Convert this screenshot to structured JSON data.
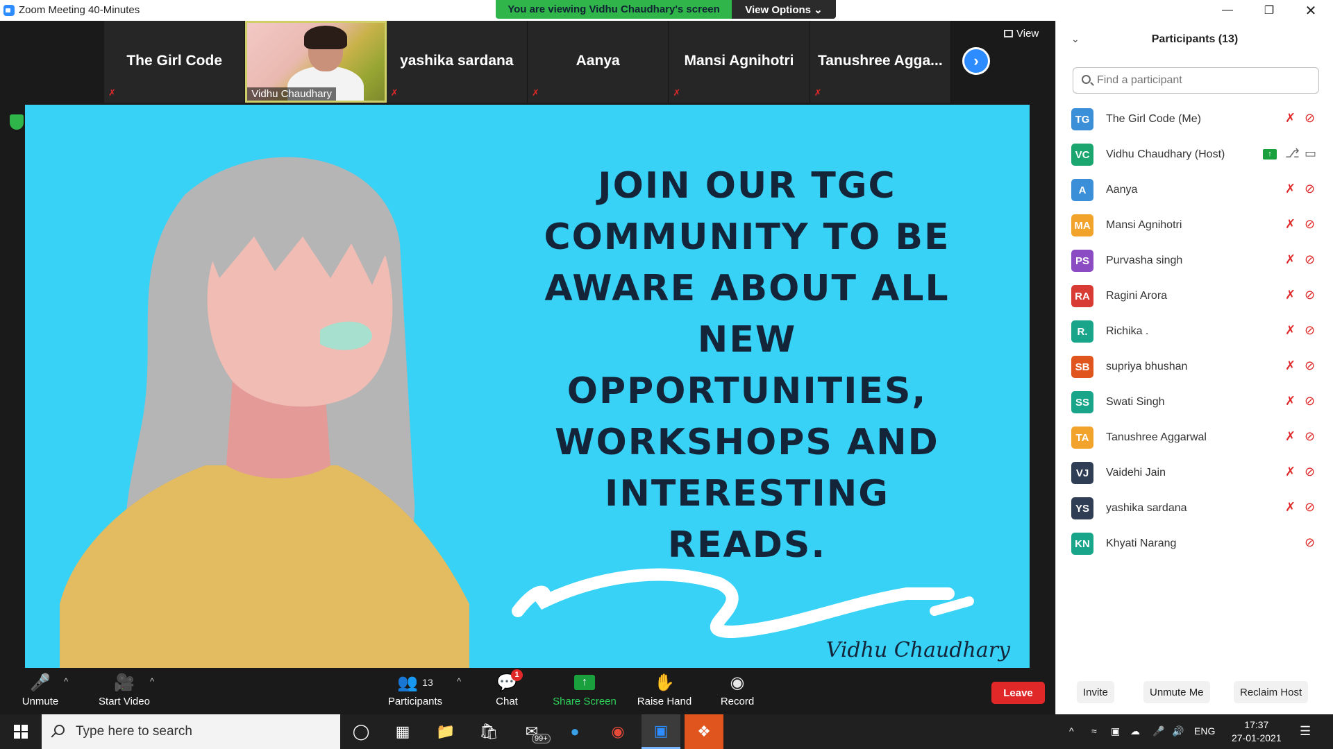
{
  "window": {
    "title": "Zoom Meeting 40-Minutes",
    "banner": "You are viewing Vidhu Chaudhary's screen",
    "view_options": "View Options ⌄"
  },
  "thumbnails": [
    {
      "name": "The Girl Code",
      "type": "name"
    },
    {
      "name": "Vidhu Chaudhary",
      "type": "video"
    },
    {
      "name": "yashika sardana",
      "type": "name"
    },
    {
      "name": "Aanya",
      "type": "name"
    },
    {
      "name": "Mansi Agnihotri",
      "type": "name"
    },
    {
      "name": "Tanushree  Agga...",
      "type": "name"
    }
  ],
  "view_label": "View",
  "slide": {
    "lines": [
      "JOIN OUR TGC",
      "COMMUNITY TO BE",
      "AWARE ABOUT ALL",
      "NEW",
      "OPPORTUNITIES,",
      "WORKSHOPS AND",
      "INTERESTING",
      "READS."
    ],
    "signature": "Vidhu Chaudhary",
    "bg_color": "#37d2f6"
  },
  "toolbar": {
    "unmute": "Unmute",
    "start_video": "Start Video",
    "participants": "Participants",
    "participant_count": "13",
    "chat": "Chat",
    "chat_badge": "1",
    "share_screen": "Share Screen",
    "raise_hand": "Raise Hand",
    "record": "Record",
    "leave": "Leave"
  },
  "sidebar": {
    "title": "Participants (13)",
    "search_placeholder": "Find a participant",
    "participants": [
      {
        "initials": "TG",
        "name": "The Girl Code (Me)",
        "color": "#3a8fd8",
        "mic": "off",
        "cam": "off"
      },
      {
        "initials": "VC",
        "name": "Vidhu Chaudhary (Host)",
        "color": "#1aa66e",
        "mic": "on",
        "cam": "on",
        "sharing": true
      },
      {
        "initials": "A",
        "name": "Aanya",
        "color": "#3a8fd8",
        "mic": "off",
        "cam": "off"
      },
      {
        "initials": "MA",
        "name": "Mansi Agnihotri",
        "color": "#f2a32b",
        "mic": "off",
        "cam": "off"
      },
      {
        "initials": "PS",
        "name": "Purvasha singh",
        "color": "#8b4bc3",
        "mic": "off",
        "cam": "off"
      },
      {
        "initials": "RA",
        "name": "Ragini Arora",
        "color": "#d83b34",
        "mic": "off",
        "cam": "off"
      },
      {
        "initials": "R.",
        "name": "Richika .",
        "color": "#19a58a",
        "mic": "off",
        "cam": "off"
      },
      {
        "initials": "SB",
        "name": "supriya bhushan",
        "color": "#e0551e",
        "mic": "off",
        "cam": "off"
      },
      {
        "initials": "SS",
        "name": "Swati Singh",
        "color": "#19a58a",
        "mic": "off",
        "cam": "off"
      },
      {
        "initials": "TA",
        "name": "Tanushree Aggarwal",
        "color": "#f2a32b",
        "mic": "off",
        "cam": "off"
      },
      {
        "initials": "VJ",
        "name": "Vaidehi Jain",
        "color": "#2f3e55",
        "mic": "off",
        "cam": "off"
      },
      {
        "initials": "YS",
        "name": "yashika sardana",
        "color": "#2f3e55",
        "mic": "off",
        "cam": "off"
      },
      {
        "initials": "KN",
        "name": "Khyati Narang",
        "color": "#19a58a",
        "mic": "none",
        "cam": "off"
      }
    ],
    "invite": "Invite",
    "unmute_me": "Unmute Me",
    "reclaim_host": "Reclaim Host"
  },
  "taskbar": {
    "search_placeholder": "Type here to search",
    "mail_badge": "99+",
    "lang": "ENG",
    "time": "17:37",
    "date": "27-01-2021"
  }
}
